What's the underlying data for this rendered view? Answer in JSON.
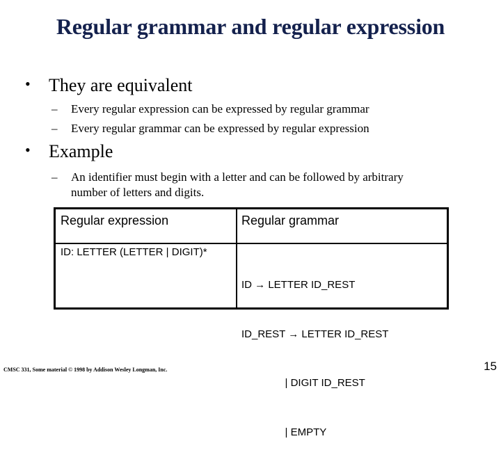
{
  "slide": {
    "title": "Regular grammar and regular expression",
    "bullets": [
      {
        "text": "They are equivalent",
        "subitems": [
          "Every regular expression can be expressed by regular grammar",
          "Every regular grammar can be expressed by regular expression"
        ]
      },
      {
        "text": "Example",
        "subitems": [
          "An identifier must begin with a letter and can be followed by arbitrary",
          "number of letters and digits."
        ]
      }
    ],
    "bullet_glyph": "•",
    "dash_glyph": "–",
    "table": {
      "headers": [
        "Regular expression",
        "Regular grammar"
      ],
      "rows": [
        {
          "regex": "ID: LETTER (LETTER | DIGIT)*",
          "grammar": [
            "ID → LETTER ID_REST",
            "ID_REST → LETTER ID_REST",
            "               | DIGIT ID_REST",
            "               | EMPTY"
          ]
        }
      ]
    },
    "footer": "CMSC 331, Some material © 1998 by Addison Wesley Longman, Inc.",
    "page_number": "15",
    "title_color": "#14214d"
  }
}
